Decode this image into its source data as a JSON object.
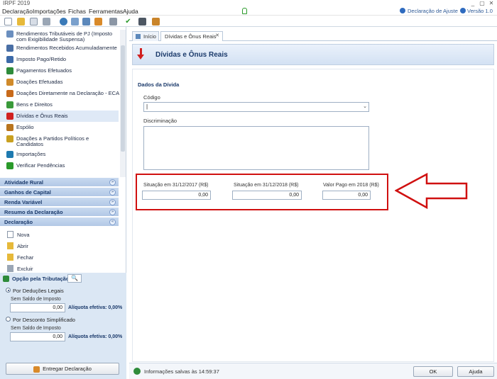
{
  "window": {
    "title": "IRPF 2019",
    "minimize": "_",
    "maximize": "▢",
    "close": "✕"
  },
  "menu": {
    "items": [
      "Declaração",
      "Importações",
      "Fichas",
      "Ferramentas",
      "Ajuda"
    ],
    "right_help": "Declaração de Ajuste",
    "right_version": "Versão 1.0"
  },
  "sidebar": {
    "nav": [
      {
        "label": "Rendimentos Tributáveis de PJ (Imposto",
        "label2": "com Exigibilidade Suspensa)",
        "color": "#6b8fbf"
      },
      {
        "label": "Rendimentos Recebidos Acumuladamente",
        "color": "#4a6fa5"
      },
      {
        "label": "Imposto Pago/Retido",
        "color": "#3c6aa8"
      },
      {
        "label": "Pagamentos Efetuados",
        "color": "#2e8b3a"
      },
      {
        "label": "Doações Efetuadas",
        "color": "#d08a2a"
      },
      {
        "label": "Doações Diretamente na Declaração - ECA",
        "color": "#c86a1a"
      },
      {
        "label": "Bens e Direitos",
        "color": "#3a9a3a"
      },
      {
        "label": "Dívidas e Ônus Reais",
        "color": "#d02020"
      },
      {
        "label": "Espólio",
        "color": "#b8741e"
      },
      {
        "label": "Doações a Partidos Políticos e",
        "label2": "Candidatos",
        "color": "#c9a020"
      },
      {
        "label": "Importações",
        "color": "#1e7ab0"
      },
      {
        "label": "Verificar Pendências",
        "color": "#2a9a2a"
      }
    ],
    "sections": [
      "Atividade Rural",
      "Ganhos de Capital",
      "Renda Variável",
      "Resumo da Declaração",
      "Declaração"
    ],
    "declaracao_items": [
      "Nova",
      "Abrir",
      "Fechar",
      "Excluir"
    ],
    "tax": {
      "title": "Opção pela Tributação:",
      "option1": "Por Deduções Legais",
      "balance_label": "Sem Saldo de Imposto",
      "value1": "0,00",
      "rate1": "Alíquota efetiva: 0,00%",
      "option2": "Por Desconto Simplificado",
      "value2": "0,00",
      "rate2": "Alíquota efetiva: 0,00%",
      "submit": "Entregar Declaração"
    }
  },
  "tabs": {
    "home": "Início",
    "active": "Dívidas e Ônus Reais"
  },
  "header": {
    "title": "Dívidas e Ônus Reais"
  },
  "form": {
    "section_title": "Dados da Dívida",
    "code_label": "Código",
    "code_value": "|",
    "description_label": "Discriminação",
    "situacao2017_label": "Situação em 31/12/2017 (R$)",
    "situacao2017_value": "0,00",
    "situacao2018_label": "Situação em 31/12/2018 (R$)",
    "situacao2018_value": "0,00",
    "pago2018_label": "Valor Pago em 2018 (R$)",
    "pago2018_value": "0,00"
  },
  "footer": {
    "status": "Informações salvas às 14:59:37",
    "ok": "OK",
    "help": "Ajuda"
  },
  "colors": {
    "accent": "#1b3a6b",
    "highlight": "#d01010"
  }
}
